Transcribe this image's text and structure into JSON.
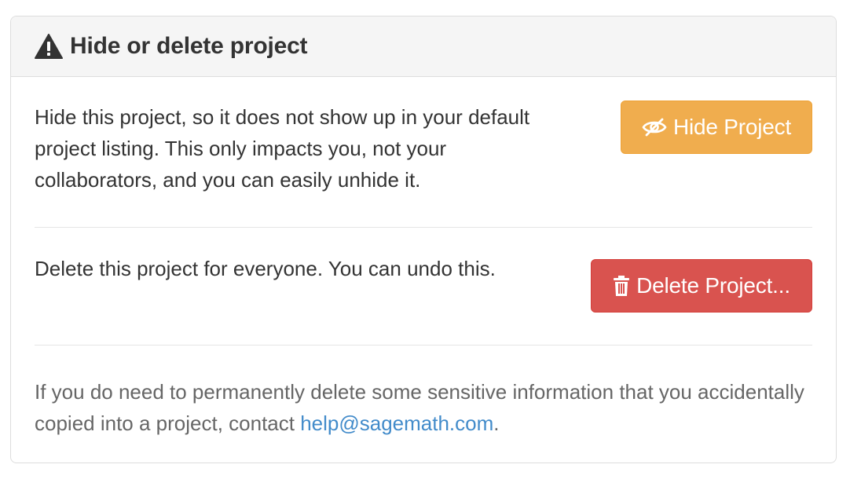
{
  "panel": {
    "title": "Hide or delete project",
    "title_icon": "warning-icon"
  },
  "hide_section": {
    "description": "Hide this project, so it does not show up in your default project listing. This only impacts you, not your collaborators, and you can easily unhide it.",
    "button_label": "Hide Project",
    "button_icon": "eye-slash-icon",
    "button_color": "#f0ad4e"
  },
  "delete_section": {
    "description": "Delete this project for everyone. You can undo this.",
    "button_label": "Delete Project...",
    "button_icon": "trash-icon",
    "button_color": "#d9534f"
  },
  "footer": {
    "text_before": "If you do need to permanently delete some sensitive information that you accidentally copied into a project, contact ",
    "email": "help@sagemath.com",
    "text_after": ".",
    "link_color": "#428bca"
  }
}
